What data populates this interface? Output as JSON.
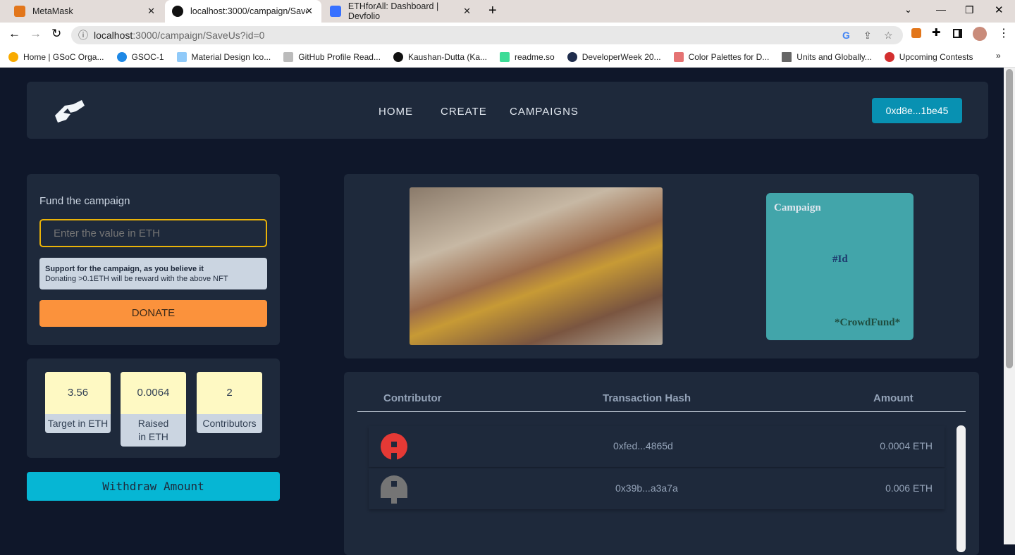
{
  "browser": {
    "tabs": [
      {
        "title": "MetaMask"
      },
      {
        "title": "localhost:3000/campaign/SaveUs"
      },
      {
        "title": "ETHforAll: Dashboard | Devfolio"
      }
    ],
    "url_host": "localhost",
    "url_rest": ":3000/campaign/SaveUs?id=0",
    "bookmarks": [
      "Home | GSoC Orga...",
      "GSOC-1",
      "Material Design Ico...",
      "GitHub Profile Read...",
      "Kaushan-Dutta (Ka...",
      "readme.so",
      "DeveloperWeek 20...",
      "Color Palettes for D...",
      "Units and Globally...",
      "Upcoming Contests"
    ],
    "more": "»"
  },
  "nav": {
    "links": [
      "HOME",
      "CREATE",
      "CAMPAIGNS"
    ],
    "wallet": "0xd8e...1be45"
  },
  "fund": {
    "title": "Fund the campaign",
    "placeholder": "Enter the value in ETH",
    "note_title": "Support for the campaign, as you believe it",
    "note_text": "Donating >0.1ETH will be reward with the above NFT",
    "donate": "DONATE"
  },
  "stats": [
    {
      "value": "3.56",
      "label": "Target in ETH"
    },
    {
      "value": "0.0064",
      "label": "Raised in ETH"
    },
    {
      "value": "2",
      "label": "Contributors"
    }
  ],
  "withdraw": "Withdraw Amount",
  "nft": {
    "title": "Campaign",
    "id": "#Id",
    "footer": "*CrowdFund*"
  },
  "table": {
    "headers": [
      "Contributor",
      "Transaction Hash",
      "Amount"
    ],
    "rows": [
      {
        "hash": "0xfed...4865d",
        "amount": "0.0004 ETH",
        "avatar_color": "#e53935"
      },
      {
        "hash": "0x39b...a3a7a",
        "amount": "0.006 ETH",
        "avatar_color": "#757575"
      }
    ]
  },
  "colors": {
    "accent": "#0891b2",
    "donate": "#fb923c",
    "withdraw": "#06b6d4",
    "nft": "#42a5aa"
  }
}
